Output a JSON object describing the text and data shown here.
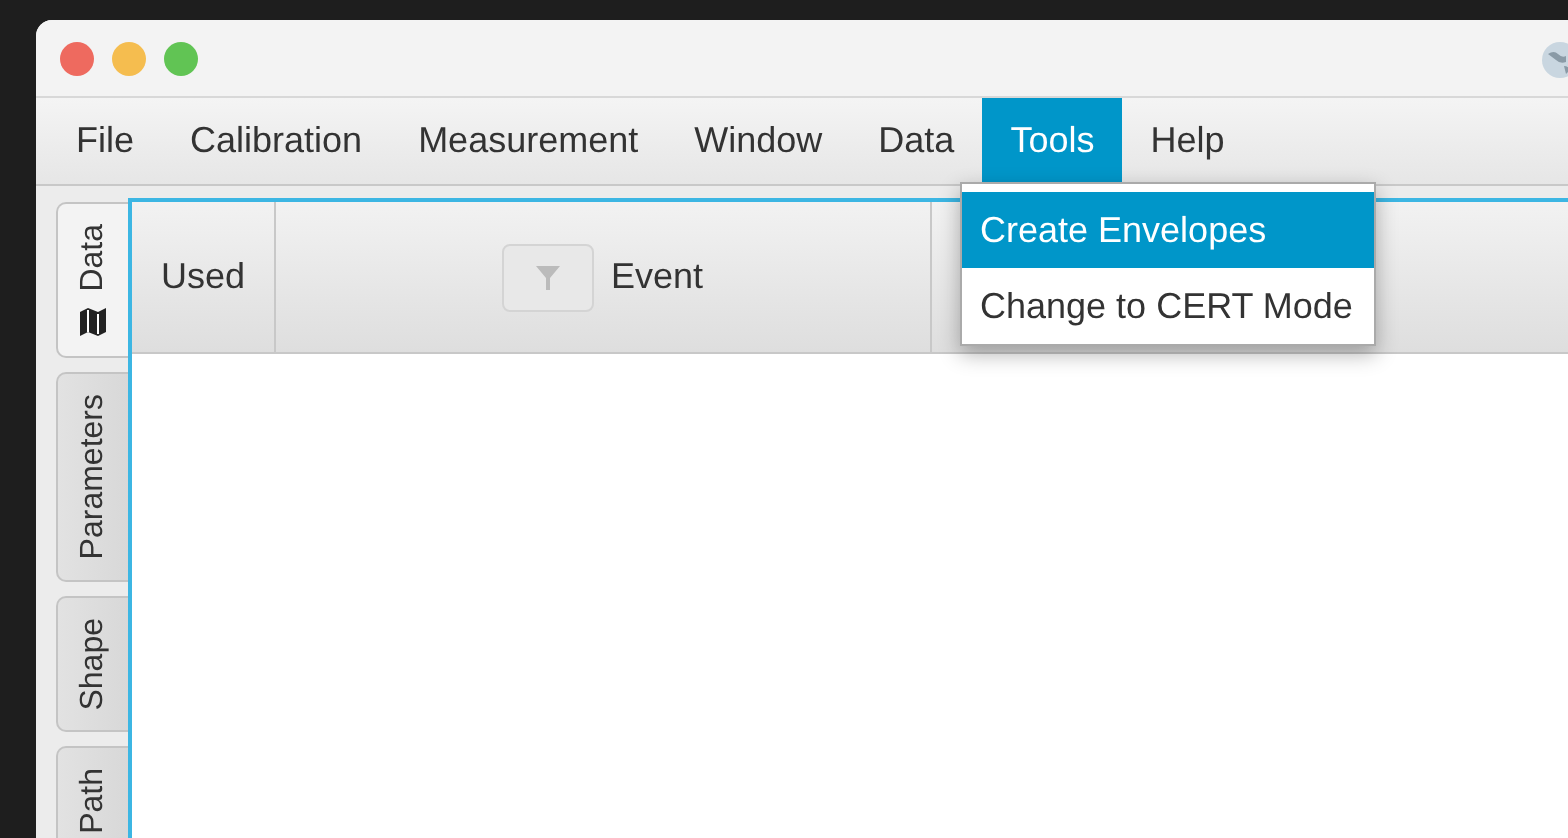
{
  "menu_bar": [
    {
      "label": "File",
      "selected": false
    },
    {
      "label": "Calibration",
      "selected": false
    },
    {
      "label": "Measurement",
      "selected": false
    },
    {
      "label": "Window",
      "selected": false
    },
    {
      "label": "Data",
      "selected": false
    },
    {
      "label": "Tools",
      "selected": true
    },
    {
      "label": "Help",
      "selected": false
    }
  ],
  "dropdown": [
    {
      "label": "Create Envelopes",
      "selected": true
    },
    {
      "label": "Change to CERT Mode",
      "selected": false
    }
  ],
  "side_tabs": [
    {
      "label": "Data",
      "selected": true
    },
    {
      "label": "Parameters",
      "selected": false
    },
    {
      "label": "Shape",
      "selected": false
    },
    {
      "label": "Path",
      "selected": false
    }
  ],
  "table": {
    "columns": [
      {
        "label": "Used",
        "filter": false
      },
      {
        "label": "Event",
        "filter": true
      }
    ]
  }
}
